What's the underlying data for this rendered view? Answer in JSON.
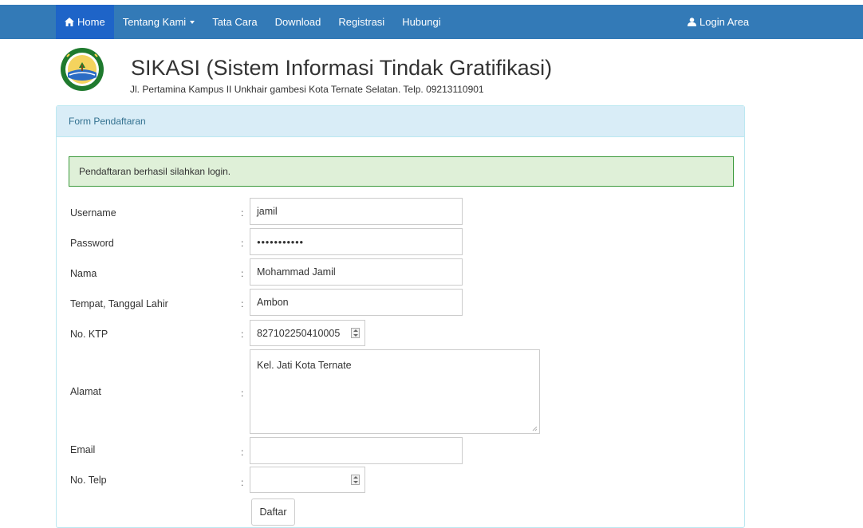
{
  "nav": {
    "home": "Home",
    "tentang_kami": "Tentang Kami",
    "tata_cara": "Tata Cara",
    "download": "Download",
    "registrasi": "Registrasi",
    "hubungi": "Hubungi",
    "login_area": "Login Area"
  },
  "header": {
    "title": "SIKASI (Sistem Informasi Tindak Gratifikasi)",
    "address": "Jl. Pertamina Kampus II Unkhair gambesi Kota Ternate Selatan. Telp. 09213110901"
  },
  "panel": {
    "heading": "Form Pendaftaran",
    "alert": "Pendaftaran berhasil silahkan login."
  },
  "form": {
    "separator": ":",
    "username": {
      "label": "Username",
      "value": "jamil"
    },
    "password": {
      "label": "Password",
      "masked_value": "●●●●●●●●●●●"
    },
    "nama": {
      "label": "Nama",
      "value": "Mohammad Jamil"
    },
    "ttl": {
      "label": "Tempat, Tanggal Lahir",
      "value": "Ambon"
    },
    "ktp": {
      "label": "No. KTP",
      "value": "827102250410005"
    },
    "alamat": {
      "label": "Alamat",
      "value": "Kel. Jati Kota Ternate"
    },
    "email": {
      "label": "Email",
      "value": ""
    },
    "telp": {
      "label": "No. Telp",
      "value": ""
    },
    "submit": "Daftar"
  },
  "icons": {
    "home": "home-icon",
    "user": "user-icon",
    "caret": "caret-down-icon",
    "logo": "university-logo"
  },
  "colors": {
    "navbar": "#337ab7",
    "nav_active": "#1e64c8",
    "panel_heading_bg": "#d9edf7",
    "panel_border": "#bce8f1",
    "alert_bg": "#dff0d8",
    "alert_border": "#3c9a3c"
  }
}
